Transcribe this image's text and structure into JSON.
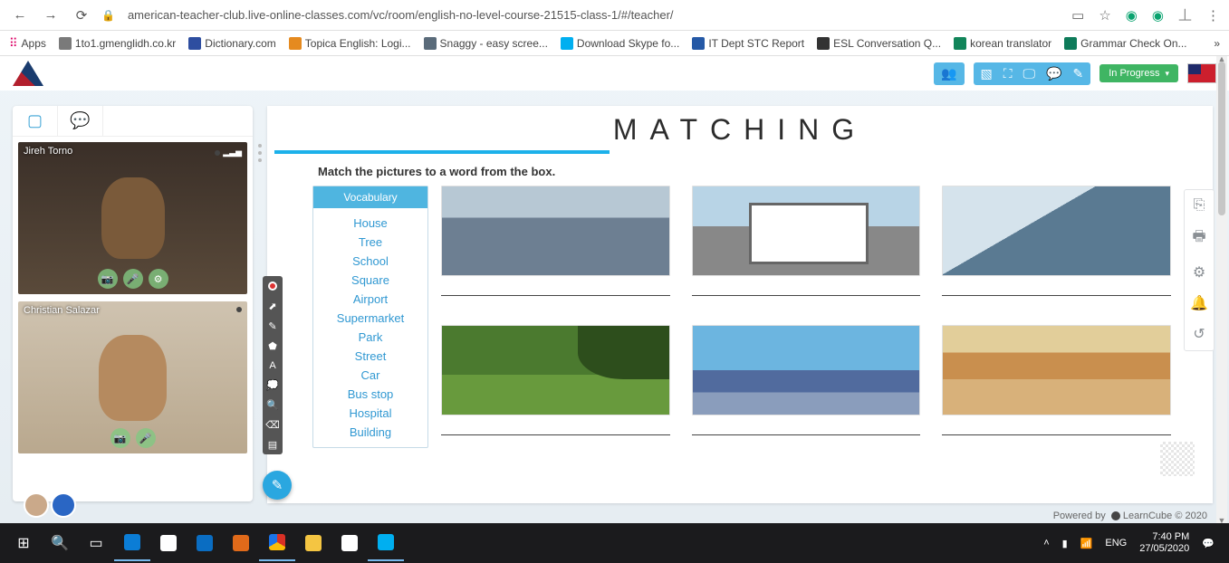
{
  "browser": {
    "url": "american-teacher-club.live-online-classes.com/vc/room/english-no-level-course-21515-class-1/#/teacher/",
    "bookmarks_label": "Apps",
    "bookmarks": [
      {
        "label": "1to1.gmenglidh.co.kr",
        "favicon": "#7a7a7a"
      },
      {
        "label": "Dictionary.com",
        "favicon": "#2e4ea0"
      },
      {
        "label": "Topica English: Logi...",
        "favicon": "#e58a1f"
      },
      {
        "label": "Snaggy - easy scree...",
        "favicon": "#5a6b7a"
      },
      {
        "label": "Download Skype fo...",
        "favicon": "#00aff0"
      },
      {
        "label": "IT Dept STC Report",
        "favicon": "#2559a6"
      },
      {
        "label": "ESL Conversation Q...",
        "favicon": "#333333"
      },
      {
        "label": "korean translator",
        "favicon": "#12855a"
      },
      {
        "label": "Grammar Check On...",
        "favicon": "#0e7b5a"
      }
    ],
    "more": "»"
  },
  "header": {
    "status": "In Progress"
  },
  "participants": [
    {
      "name": "Jireh Torno"
    },
    {
      "name": "Christian Salazar"
    }
  ],
  "slide": {
    "title": "MATCHING",
    "subtitle": "Match the pictures to a word from the box.",
    "vocab_header": "Vocabulary",
    "vocab": [
      "House",
      "Tree",
      "School",
      "Square",
      "Airport",
      "Supermarket",
      "Park",
      "Street",
      "Car",
      "Bus stop",
      "Hospital",
      "Building"
    ]
  },
  "footer": {
    "text_prefix": "Powered by ",
    "brand": "LearnCube",
    "text_suffix": " © 2020"
  },
  "taskbar": {
    "lang": "ENG",
    "time": "7:40 PM",
    "date": "27/05/2020"
  }
}
